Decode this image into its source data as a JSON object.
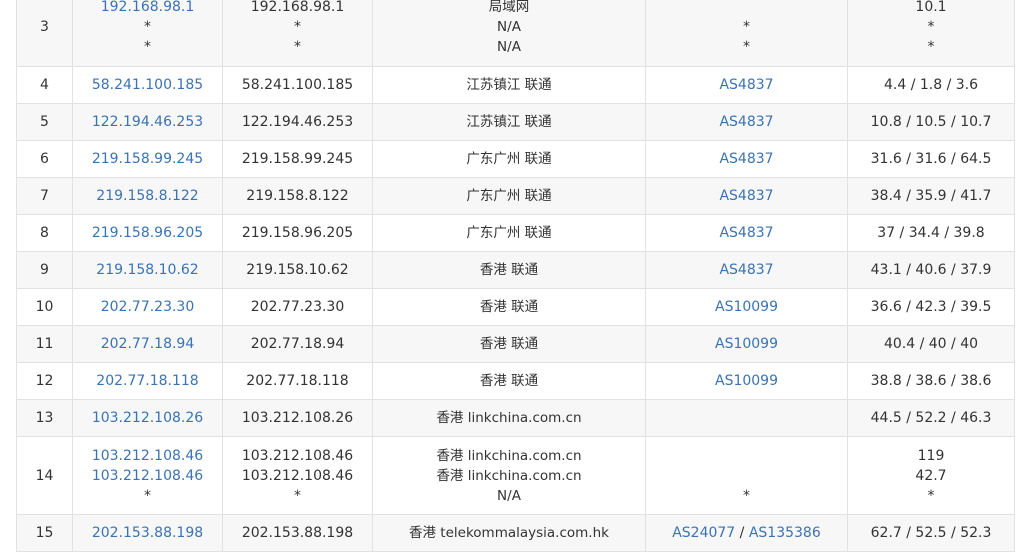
{
  "rows": [
    {
      "hop": "3",
      "ip": [
        "192.168.98.1",
        "*",
        "*"
      ],
      "host": [
        "192.168.98.1",
        "*",
        "*"
      ],
      "location": [
        "局域网",
        "N/A",
        "N/A"
      ],
      "asn": [
        "",
        "*",
        "*"
      ],
      "latency": [
        "10.1",
        "*",
        "*"
      ]
    },
    {
      "hop": "4",
      "ip": [
        "58.241.100.185"
      ],
      "host": [
        "58.241.100.185"
      ],
      "location": [
        "江苏镇江 联通"
      ],
      "asn": [
        "AS4837"
      ],
      "latency": [
        "4.4 / 1.8 / 3.6"
      ]
    },
    {
      "hop": "5",
      "ip": [
        "122.194.46.253"
      ],
      "host": [
        "122.194.46.253"
      ],
      "location": [
        "江苏镇江 联通"
      ],
      "asn": [
        "AS4837"
      ],
      "latency": [
        "10.8 / 10.5 / 10.7"
      ]
    },
    {
      "hop": "6",
      "ip": [
        "219.158.99.245"
      ],
      "host": [
        "219.158.99.245"
      ],
      "location": [
        "广东广州 联通"
      ],
      "asn": [
        "AS4837"
      ],
      "latency": [
        "31.6 / 31.6 / 64.5"
      ]
    },
    {
      "hop": "7",
      "ip": [
        "219.158.8.122"
      ],
      "host": [
        "219.158.8.122"
      ],
      "location": [
        "广东广州 联通"
      ],
      "asn": [
        "AS4837"
      ],
      "latency": [
        "38.4 / 35.9 / 41.7"
      ]
    },
    {
      "hop": "8",
      "ip": [
        "219.158.96.205"
      ],
      "host": [
        "219.158.96.205"
      ],
      "location": [
        "广东广州 联通"
      ],
      "asn": [
        "AS4837"
      ],
      "latency": [
        "37 / 34.4 / 39.8"
      ]
    },
    {
      "hop": "9",
      "ip": [
        "219.158.10.62"
      ],
      "host": [
        "219.158.10.62"
      ],
      "location": [
        "香港 联通"
      ],
      "asn": [
        "AS4837"
      ],
      "latency": [
        "43.1 / 40.6 / 37.9"
      ]
    },
    {
      "hop": "10",
      "ip": [
        "202.77.23.30"
      ],
      "host": [
        "202.77.23.30"
      ],
      "location": [
        "香港 联通"
      ],
      "asn": [
        "AS10099"
      ],
      "latency": [
        "36.6 / 42.3 / 39.5"
      ]
    },
    {
      "hop": "11",
      "ip": [
        "202.77.18.94"
      ],
      "host": [
        "202.77.18.94"
      ],
      "location": [
        "香港 联通"
      ],
      "asn": [
        "AS10099"
      ],
      "latency": [
        "40.4 / 40 / 40"
      ]
    },
    {
      "hop": "12",
      "ip": [
        "202.77.18.118"
      ],
      "host": [
        "202.77.18.118"
      ],
      "location": [
        "香港 联通"
      ],
      "asn": [
        "AS10099"
      ],
      "latency": [
        "38.8 / 38.6 / 38.6"
      ]
    },
    {
      "hop": "13",
      "ip": [
        "103.212.108.26"
      ],
      "host": [
        "103.212.108.26"
      ],
      "location": [
        "香港 linkchina.com.cn"
      ],
      "asn": [
        ""
      ],
      "latency": [
        "44.5 / 52.2 / 46.3"
      ]
    },
    {
      "hop": "14",
      "ip": [
        "103.212.108.46",
        "103.212.108.46",
        "*"
      ],
      "host": [
        "103.212.108.46",
        "103.212.108.46",
        "*"
      ],
      "location": [
        "香港 linkchina.com.cn",
        "香港 linkchina.com.cn",
        "N/A"
      ],
      "asn": [
        "",
        "",
        "*"
      ],
      "latency": [
        "119",
        "42.7",
        "*"
      ]
    },
    {
      "hop": "15",
      "ip": [
        "202.153.88.198"
      ],
      "host": [
        "202.153.88.198"
      ],
      "location": [
        "香港 telekommalaysia.com.hk"
      ],
      "asn": [
        "AS24077",
        "AS135386"
      ],
      "asn_separator": " / ",
      "latency": [
        "62.7 / 52.5 / 52.3"
      ]
    }
  ],
  "colors": {
    "link": "#3a73b3",
    "row_alt": "#f7f7f7",
    "border": "#e2e2e2",
    "text": "#333333"
  }
}
